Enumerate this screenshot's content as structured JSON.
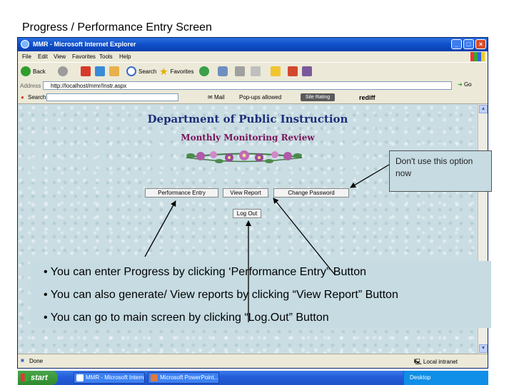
{
  "slide": {
    "title": "Progress / Performance Entry Screen"
  },
  "window": {
    "title": "MMR - Microsoft Internet Explorer",
    "controls": {
      "minimize": "_",
      "maximize": "□",
      "close": "×"
    }
  },
  "menu": {
    "items": [
      "File",
      "Edit",
      "View",
      "Favorites",
      "Tools",
      "Help"
    ]
  },
  "toolbar": {
    "back_label": "Back",
    "search_label": "Search",
    "favorites_label": "Favorites"
  },
  "address": {
    "label": "Address",
    "value": "http://localhost/mmr/Instr.aspx",
    "go_label": "Go"
  },
  "links_bar": {
    "search_label": "Search",
    "mail_label": "Mail",
    "popups_label": "Pop-ups allowed",
    "site_rating": "Site Rating",
    "rediff": "rediff"
  },
  "page": {
    "department": "Department of Public Instruction",
    "review": "Monthly Monitoring Review",
    "buttons": {
      "performance_entry": "Performance Entry",
      "view_report": "View Report",
      "change_password": "Change Password",
      "logout": "Log Out"
    }
  },
  "status": {
    "text": "Done",
    "zone": "Local intranet"
  },
  "taskbar": {
    "start": "start",
    "tasks": [
      "MMR - Microsoft Internet...",
      "Microsoft PowerPoint..."
    ],
    "tray": "Desktop"
  },
  "callout": {
    "text": "Don't use this option now"
  },
  "notes": [
    "• You can enter Progress by clicking ‘Performance Entry” Button",
    "• You can also generate/ View reports by clicking “View Report” Button",
    "• You can go to main screen by clicking “Log.Out” Button"
  ],
  "colors": {
    "page_background": "#c9dde3",
    "department_title": "#1e2f7a",
    "review_title": "#7a1458",
    "note_background": "#c6dbe2",
    "xp_titlebar": "#0f4fc8"
  }
}
